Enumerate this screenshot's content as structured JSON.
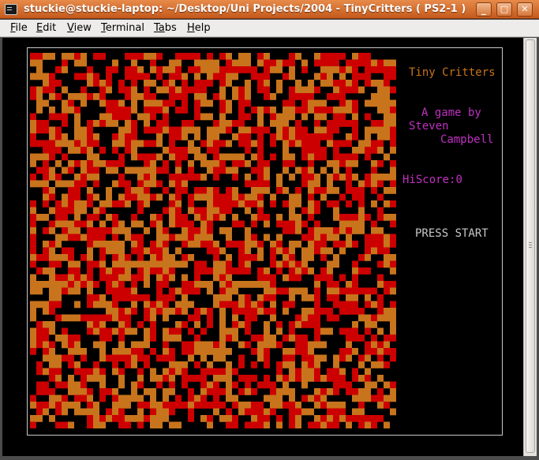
{
  "window": {
    "title": "stuckie@stuckie-laptop: ~/Desktop/Uni Projects/2004 - TinyCritters ( PS2-1 )",
    "buttons": {
      "minimize": "_",
      "maximize": "□",
      "close": "✕"
    }
  },
  "menubar": {
    "items": [
      {
        "mnemonic": "F",
        "rest": "ile"
      },
      {
        "mnemonic": "E",
        "rest": "dit"
      },
      {
        "mnemonic": "V",
        "rest": "iew"
      },
      {
        "mnemonic": "T",
        "rest": "erminal"
      },
      {
        "mnemonic": "Ta",
        "rest": "bs"
      },
      {
        "mnemonic": "H",
        "rest": "elp"
      }
    ]
  },
  "game": {
    "title": "Tiny Critters",
    "credit_line1": "A game by",
    "credit_line2": "Steven",
    "credit_line3": "Campbell",
    "hiscore_label": "HiScore:",
    "hiscore_value": "0",
    "prompt": "PRESS START",
    "colors": {
      "red": "#cc0000",
      "orange": "#c8741c",
      "title": "#c8741c",
      "credit": "#c030c0",
      "prompt": "#c8c8c8",
      "border": "#c8c8c8"
    }
  }
}
